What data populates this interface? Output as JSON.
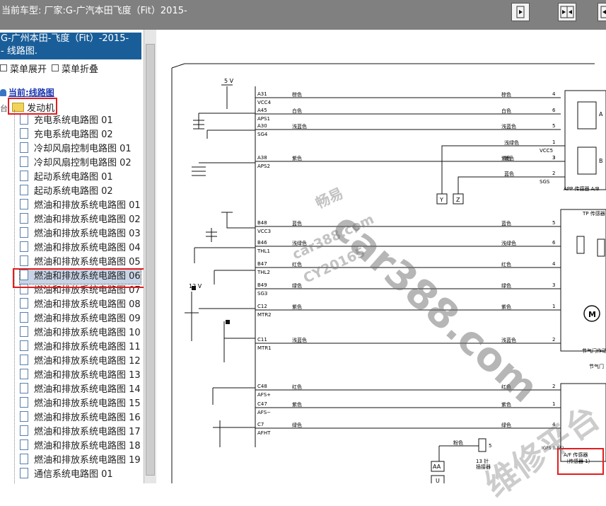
{
  "top_bar": {
    "title": "当前车型:  厂家:G-广汽本田飞度（Fit）2015-",
    "buttons": [
      "expand-right-button",
      "split-view-button",
      "collapse-left-button"
    ]
  },
  "left_panel": {
    "header_line1": "G-广州本田-飞度（Fit）-2015-",
    "header_line2": "- 线路图.",
    "expand_label": "菜单展开",
    "collapse_label": "菜单折叠",
    "current_label": "当前:线路图",
    "folder_label": "发动机",
    "items": [
      "充电系统电路图 01",
      "充电系统电路图 02",
      "冷却风扇控制电路图 01",
      "冷却风扇控制电路图 02",
      "起动系统电路图 01",
      "起动系统电路图 02",
      "燃油和排放系统电路图 01",
      "燃油和排放系统电路图 02",
      "燃油和排放系统电路图 03",
      "燃油和排放系统电路图 04",
      "燃油和排放系统电路图 05",
      "燃油和排放系统电路图 06",
      "燃油和排放系统电路图 07",
      "燃油和排放系统电路图 08",
      "燃油和排放系统电路图 09",
      "燃油和排放系统电路图 10",
      "燃油和排放系统电路图 11",
      "燃油和排放系统电路图 12",
      "燃油和排放系统电路图 13",
      "燃油和排放系统电路图 14",
      "燃油和排放系统电路图 15",
      "燃油和排放系统电路图 16",
      "燃油和排放系统电路图 17",
      "燃油和排放系统电路图 18",
      "燃油和排放系统电路图 19",
      "通信系统电路图 01"
    ],
    "selected_index": 11
  },
  "diagram": {
    "voltage_5v": "5 V",
    "voltage_12v": "12 V",
    "pins": [
      {
        "pin": "A31",
        "sig": "VCC4",
        "color": "棕色",
        "num": "4"
      },
      {
        "pin": "A45",
        "sig": "APS1",
        "color": "白色",
        "num": "6"
      },
      {
        "pin": "A30",
        "sig": "SG4",
        "color": "浅蓝色",
        "num": "5"
      },
      {
        "pin": "A38",
        "sig": "APS2",
        "color": "紫色",
        "num": "3"
      },
      {
        "pin": "B48",
        "sig": "VCC3",
        "color": "蓝色",
        "num": "5"
      },
      {
        "pin": "B46",
        "sig": "THL1",
        "color": "浅绿色",
        "num": "6"
      },
      {
        "pin": "B47",
        "sig": "THL2",
        "color": "红色",
        "num": "4"
      },
      {
        "pin": "B49",
        "sig": "SG3",
        "color": "绿色",
        "num": "3"
      },
      {
        "pin": "C12",
        "sig": "MTR2",
        "color": "紫色",
        "num": "1"
      },
      {
        "pin": "C11",
        "sig": "MTR1",
        "color": "浅蓝色",
        "num": "2"
      },
      {
        "pin": "C48",
        "sig": "AFS+",
        "color": "红色",
        "num": "2"
      },
      {
        "pin": "C47",
        "sig": "AFS−",
        "color": "紫色",
        "num": "1"
      },
      {
        "pin": "C7",
        "sig": "AFHT",
        "color": "绿色",
        "num": "4"
      }
    ],
    "app_sensor_wires": [
      {
        "color": "浅绿色",
        "sig": "VCC5",
        "num": "1"
      },
      {
        "color": "紫色",
        "sig": "",
        "num": "3"
      },
      {
        "color": "蓝色",
        "sig": "SGS",
        "num": "2"
      }
    ],
    "app_sensor_label": "APP 传感器 A/B",
    "app_a": "A",
    "app_b": "B",
    "conn_y": "Y",
    "conn_z": "Z",
    "tp_sensor_label": "TP 传感器",
    "throttle_label": "节气门作动",
    "throttle_label2": "节气门",
    "motor_label": "M",
    "af_label1": "A/F 传感器",
    "af_label2": "（传感器 1）",
    "igfs_label": "IGFS (LAF)",
    "pink_label": "粉色",
    "pin5": "5",
    "pin13_1": "13 针",
    "pin13_2": "插接器",
    "conn_aa": "AA",
    "conn_u": "U"
  },
  "watermark": {
    "line1": "畅易",
    "line2": "car388.com",
    "line3": "CY20165",
    "big": "car388.com",
    "corner": "维修平台"
  },
  "colors": {
    "topbar_bg": "#808080",
    "header_bg": "#1a5e99",
    "highlight_red": "#e31d1d",
    "selected_bg": "#c8d4e6"
  }
}
